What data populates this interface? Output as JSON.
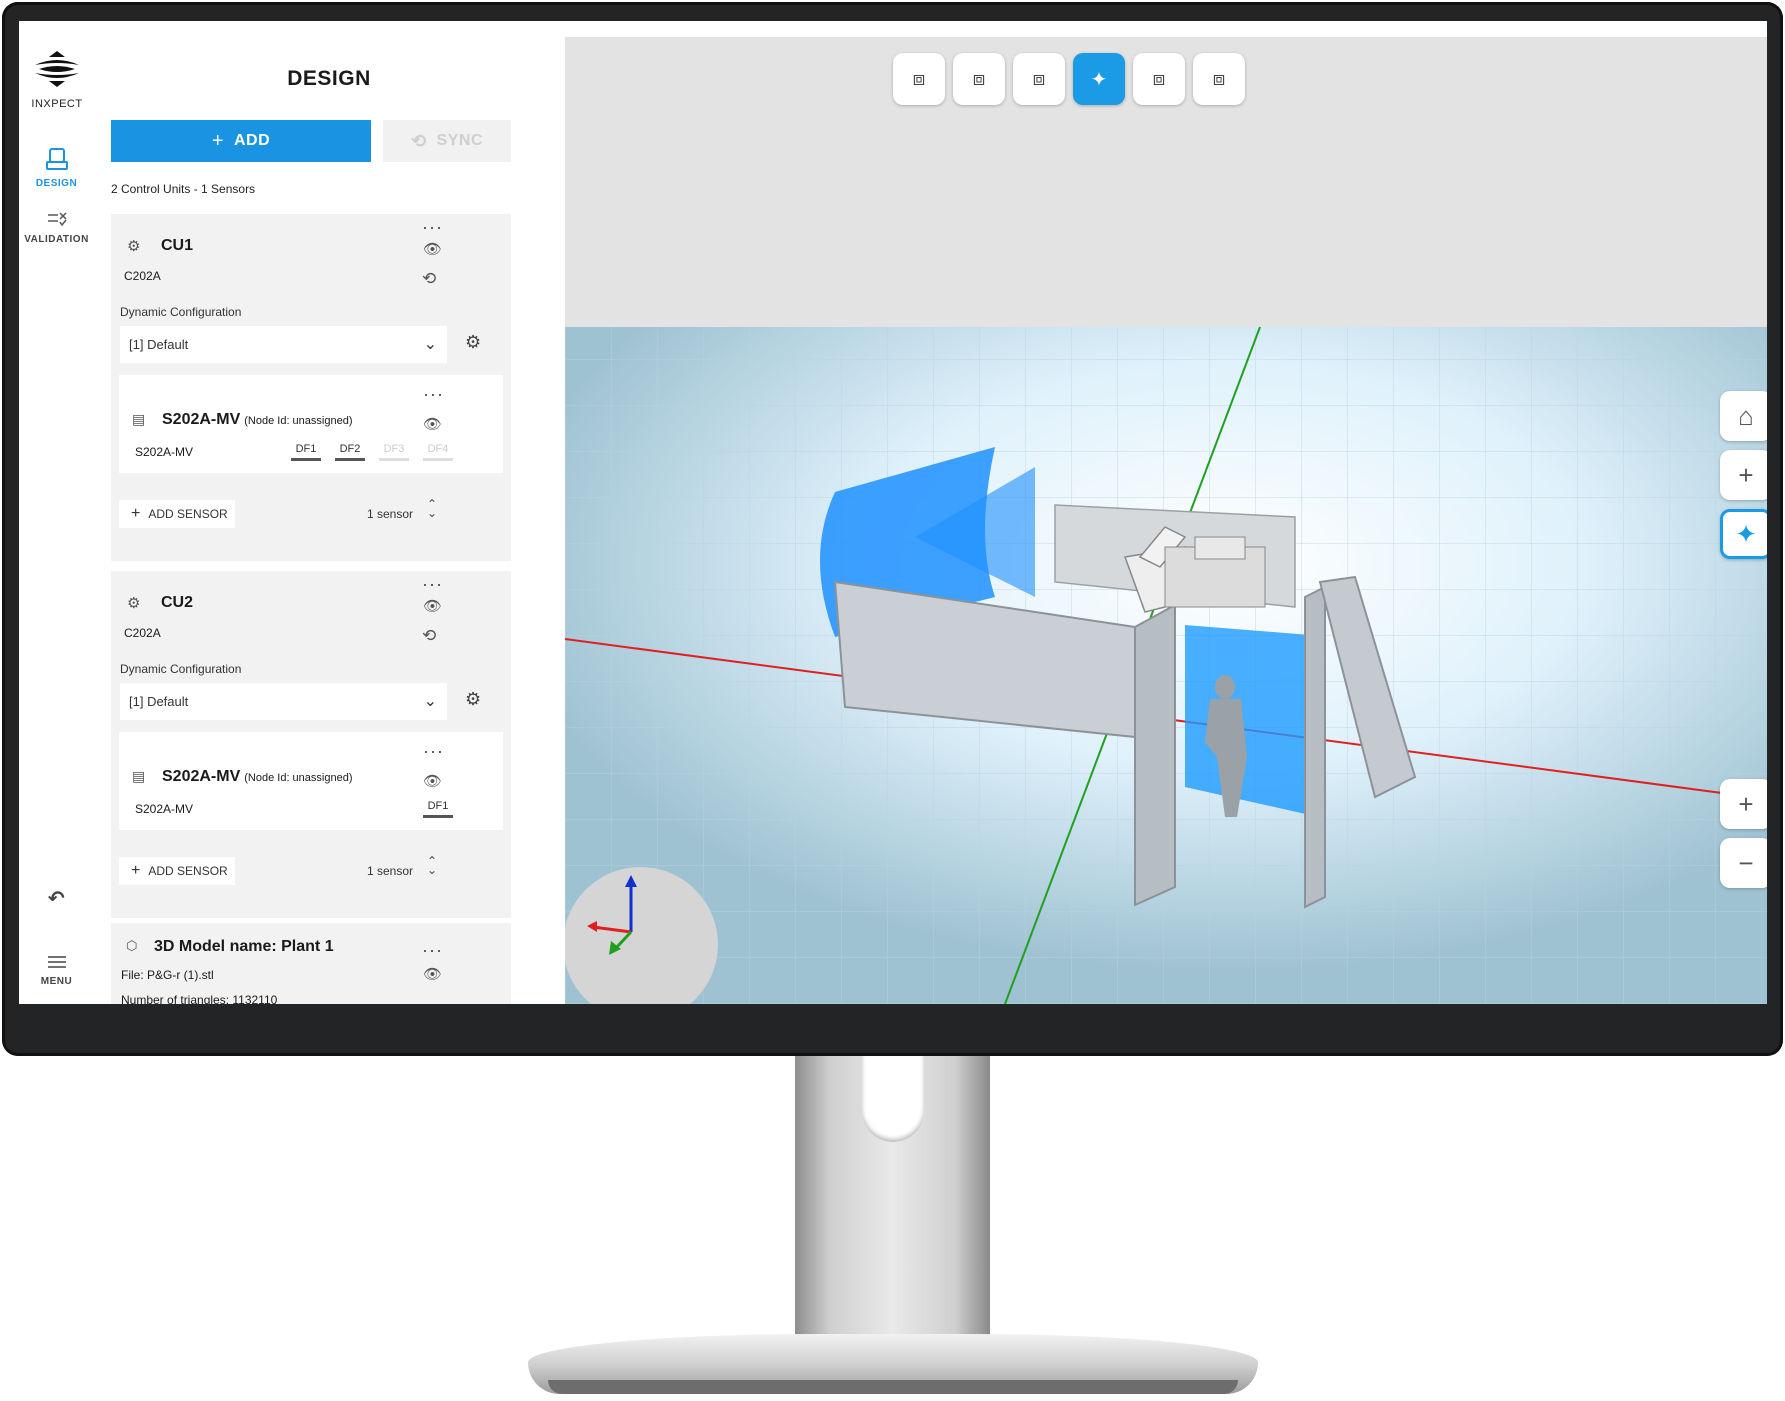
{
  "brand": {
    "name": "INXPECT"
  },
  "rail": {
    "design_label": "DESIGN",
    "validation_label": "VALIDATION",
    "undo_icon": "undo-icon",
    "menu_label": "MENU"
  },
  "panel": {
    "title": "DESIGN",
    "add_label": "ADD",
    "sync_label": "SYNC",
    "summary": "2 Control Units - 1 Sensors"
  },
  "control_units": [
    {
      "name": "CU1",
      "model": "C202A",
      "dyn_config_label": "Dynamic Configuration",
      "dyn_config_value": "[1] Default",
      "sensor": {
        "name": "S202A-MV",
        "node": "(Node Id: unassigned)",
        "model": "S202A-MV",
        "dfs": [
          {
            "label": "DF1",
            "active": true
          },
          {
            "label": "DF2",
            "active": true
          },
          {
            "label": "DF3",
            "active": false
          },
          {
            "label": "DF4",
            "active": false
          }
        ]
      },
      "add_sensor_label": "ADD SENSOR",
      "sensor_count": "1 sensor"
    },
    {
      "name": "CU2",
      "model": "C202A",
      "dyn_config_label": "Dynamic Configuration",
      "dyn_config_value": "[1] Default",
      "sensor": {
        "name": "S202A-MV",
        "node": "(Node Id: unassigned)",
        "model": "S202A-MV",
        "dfs": [
          {
            "label": "DF1",
            "active": true
          }
        ]
      },
      "add_sensor_label": "ADD SENSOR",
      "sensor_count": "1 sensor"
    }
  ],
  "model": {
    "name": "3D Model name: Plant 1",
    "file": "File: P&G-r (1).stl",
    "triangles": "Number of triangles: 1132110"
  },
  "viewport": {
    "view_buttons": [
      "cube-front-icon",
      "cube-side-icon",
      "cube-top-icon",
      "orbit-icon",
      "cube-back-icon",
      "cube-iso-icon"
    ],
    "active_view": 3,
    "side_buttons": [
      "home-icon",
      "pan-icon",
      "orbit-icon",
      "zoom-in-icon",
      "zoom-out-icon"
    ]
  },
  "colors": {
    "accent": "#1b93e3",
    "fov": "#1e90ff",
    "axis_x": "#e02020",
    "axis_y": "#1fa01f",
    "axis_z": "#1030d0"
  }
}
